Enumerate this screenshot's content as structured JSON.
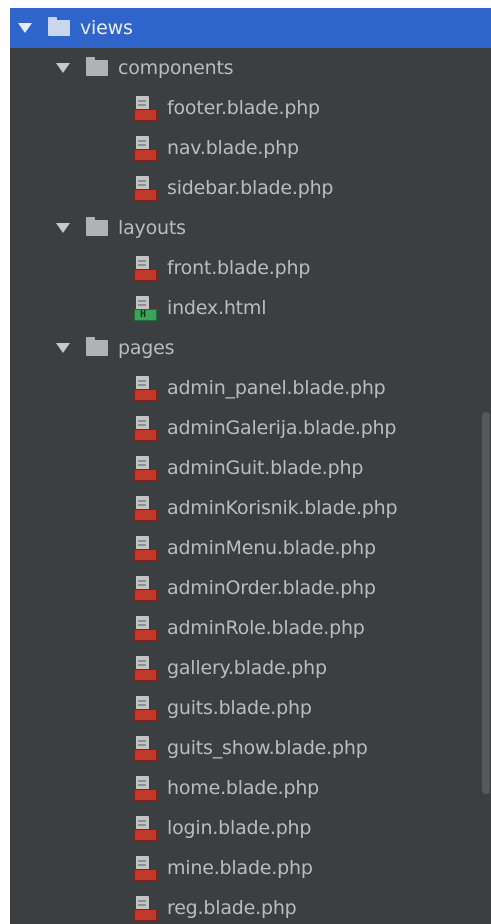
{
  "tree": {
    "root": {
      "label": "views",
      "expanded": true,
      "selected": true
    },
    "components": {
      "label": "components",
      "files": [
        "footer.blade.php",
        "nav.blade.php",
        "sidebar.blade.php"
      ]
    },
    "layouts": {
      "label": "layouts",
      "files": [
        "front.blade.php",
        "index.html"
      ]
    },
    "pages": {
      "label": "pages",
      "files": [
        "admin_panel.blade.php",
        "adminGalerija.blade.php",
        "adminGuit.blade.php",
        "adminKorisnik.blade.php",
        "adminMenu.blade.php",
        "adminOrder.blade.php",
        "adminRole.blade.php",
        "gallery.blade.php",
        "guits.blade.php",
        "guits_show.blade.php",
        "home.blade.php",
        "login.blade.php",
        "mine.blade.php",
        "reg.blade.php"
      ]
    }
  },
  "icons": {
    "folder": "folder-icon",
    "blade": "php-blade-file-icon",
    "html": "html-file-icon",
    "expand": "expand-arrow-icon"
  },
  "colors": {
    "panel_bg": "#3c3f41",
    "selected_bg": "#2f65ca",
    "text": "#bbbbbb",
    "blade_badge": "#c0392b",
    "html_badge": "#3aa557"
  },
  "badges": {
    "html_tag": "H"
  }
}
